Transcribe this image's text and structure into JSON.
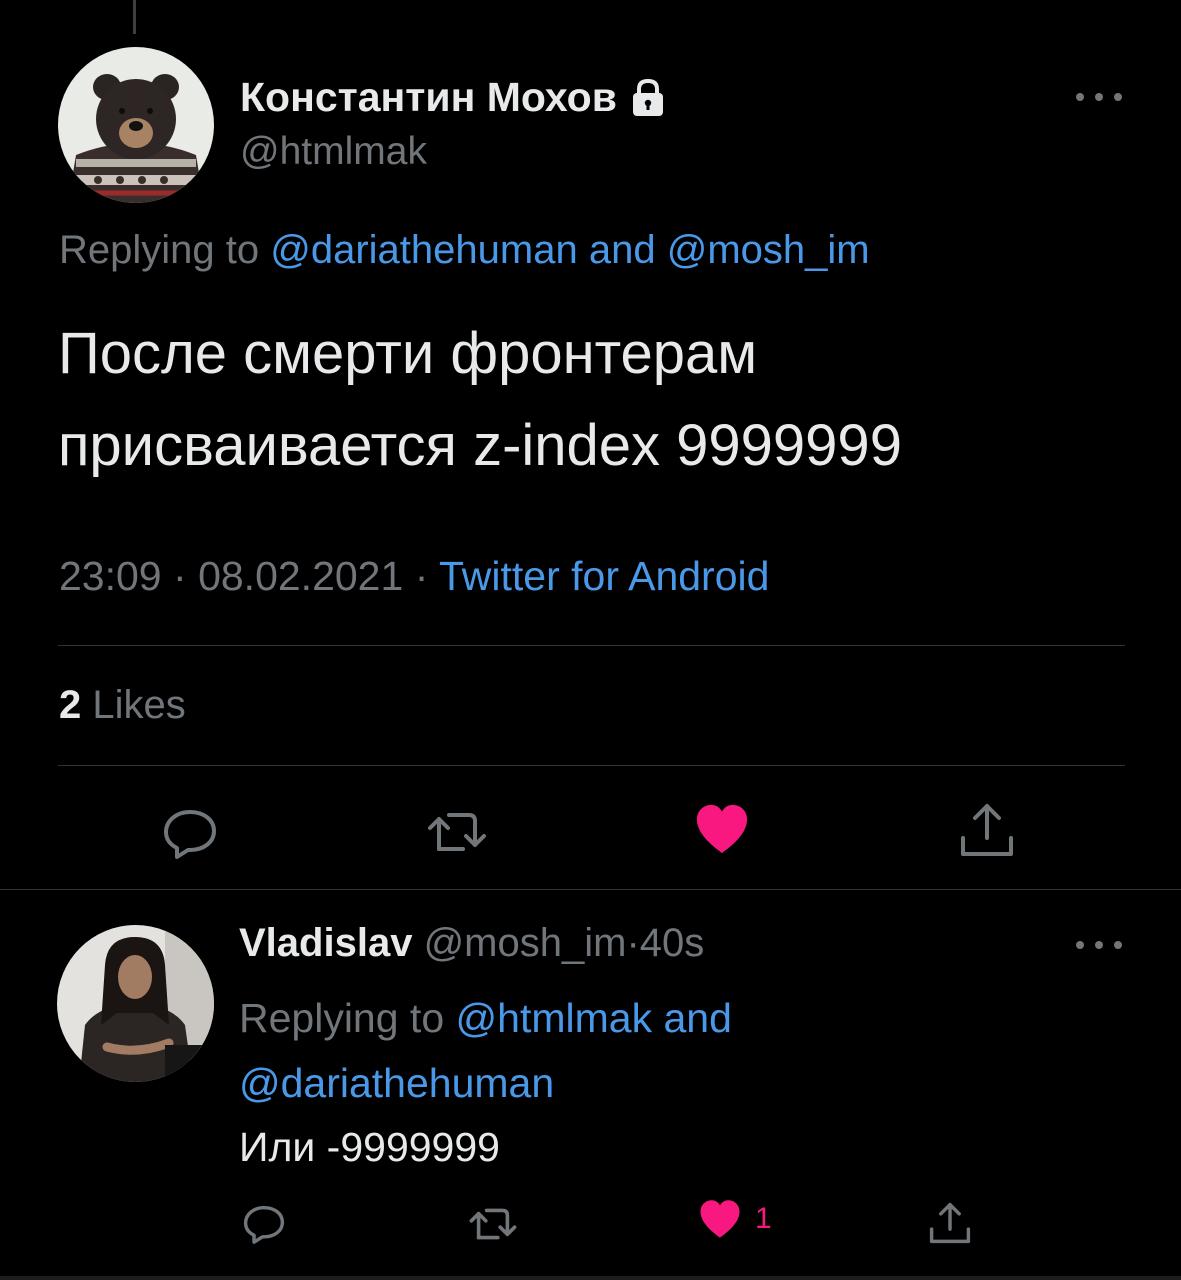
{
  "main_tweet": {
    "author": {
      "display_name": "Константин Мохов",
      "handle": "@htmlmak",
      "protected_icon": "lock-icon"
    },
    "replying": {
      "prefix": "Replying to",
      "mention1": "@dariathehuman",
      "conjunction": "and",
      "mention2": "@mosh_im"
    },
    "text_line1": "После смерти фронтерам",
    "text_line2": "присваивается z-index 9999999",
    "time": "23:09",
    "date": "08.02.2021",
    "separator": "·",
    "source": "Twitter for Android",
    "likes_count": "2",
    "likes_label": "Likes",
    "liked": true
  },
  "reply_tweet": {
    "display_name": "Vladislav",
    "handle": "@mosh_im",
    "separator": "·",
    "age": "40s",
    "replying": {
      "prefix": "Replying to",
      "mention1": "@htmlmak",
      "conjunction": "and",
      "mention2": "@dariathehuman"
    },
    "text": "Или -9999999",
    "like_count": "1",
    "liked": true
  },
  "colors": {
    "background": "#000000",
    "text": "#e7e9ea",
    "muted": "#71767b",
    "link": "#4a99e9",
    "like": "#f91880",
    "divider": "#2f3336"
  },
  "icons": {
    "reply": "reply-icon",
    "retweet": "retweet-icon",
    "like": "heart-icon",
    "share": "share-icon",
    "more": "more-icon"
  }
}
